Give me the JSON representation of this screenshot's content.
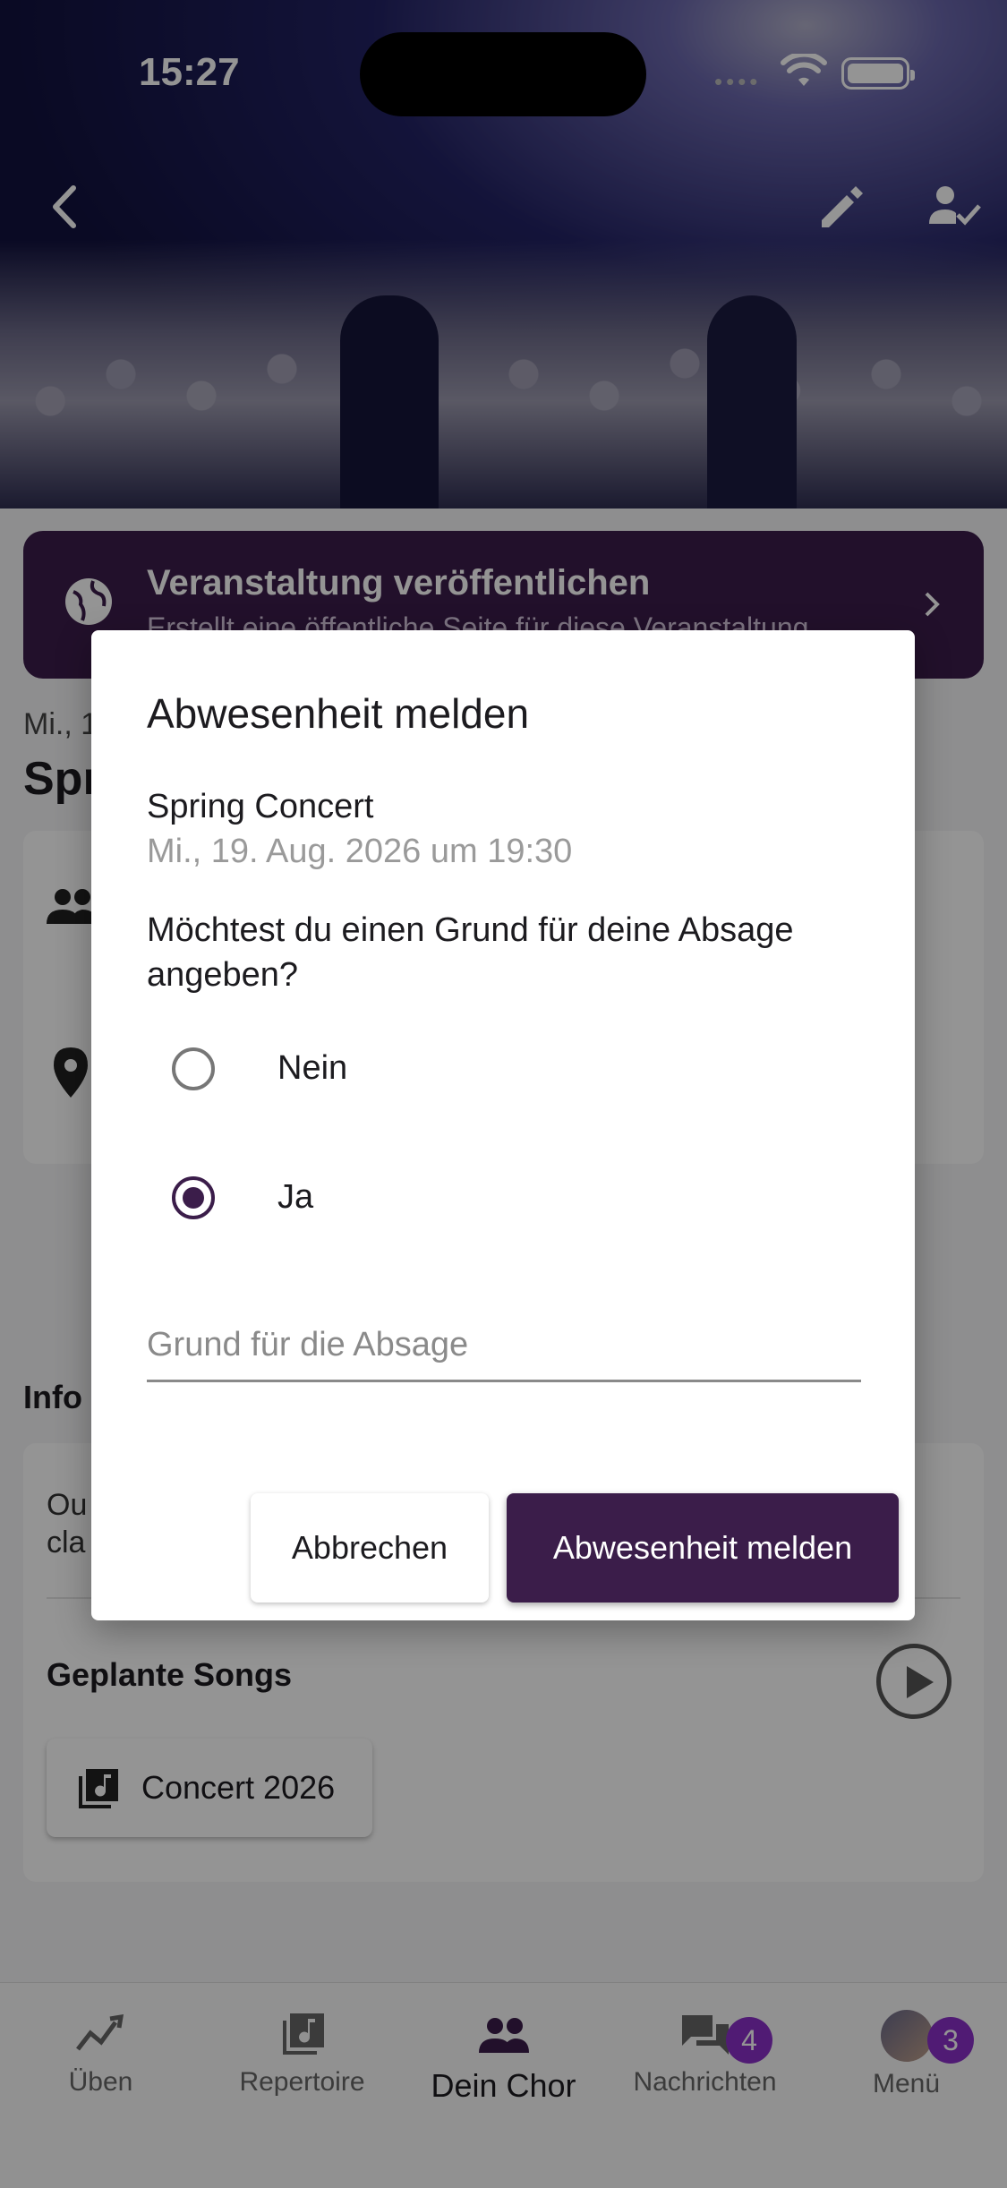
{
  "status_bar": {
    "time": "15:27"
  },
  "publish_banner": {
    "title": "Veranstaltung veröffentlichen",
    "subtitle": "Erstellt eine öffentliche Seite für diese Veranstaltung"
  },
  "event": {
    "date_short": "Mi., 1",
    "title_partial": "Spr"
  },
  "info": {
    "heading_partial": "Info",
    "description_partial_line1": "Ou",
    "description_partial_line2": "cla",
    "planned_songs_label": "Geplante Songs",
    "song_chip_label": "Concert 2026"
  },
  "dialog": {
    "title": "Abwesenheit melden",
    "event_name": "Spring Concert",
    "event_datetime": "Mi., 19. Aug. 2026 um 19:30",
    "question": "Möchtest du einen Grund für deine Absage angeben?",
    "options": [
      {
        "label": "Nein",
        "selected": false
      },
      {
        "label": "Ja",
        "selected": true
      }
    ],
    "reason_placeholder": "Grund für die Absage",
    "reason_value": "",
    "cancel_label": "Abbrechen",
    "confirm_label": "Abwesenheit melden"
  },
  "bottom_nav": {
    "items": [
      {
        "label": "Üben",
        "icon": "chart-trend-icon"
      },
      {
        "label": "Repertoire",
        "icon": "music-library-icon"
      },
      {
        "label": "Dein Chor",
        "icon": "group-icon",
        "active": true
      },
      {
        "label": "Nachrichten",
        "icon": "chat-icon",
        "badge": "4"
      },
      {
        "label": "Menü",
        "icon": "avatar",
        "badge": "3"
      }
    ]
  },
  "colors": {
    "brand_primary": "#3b1d4a",
    "badge": "#8b2fc9"
  }
}
